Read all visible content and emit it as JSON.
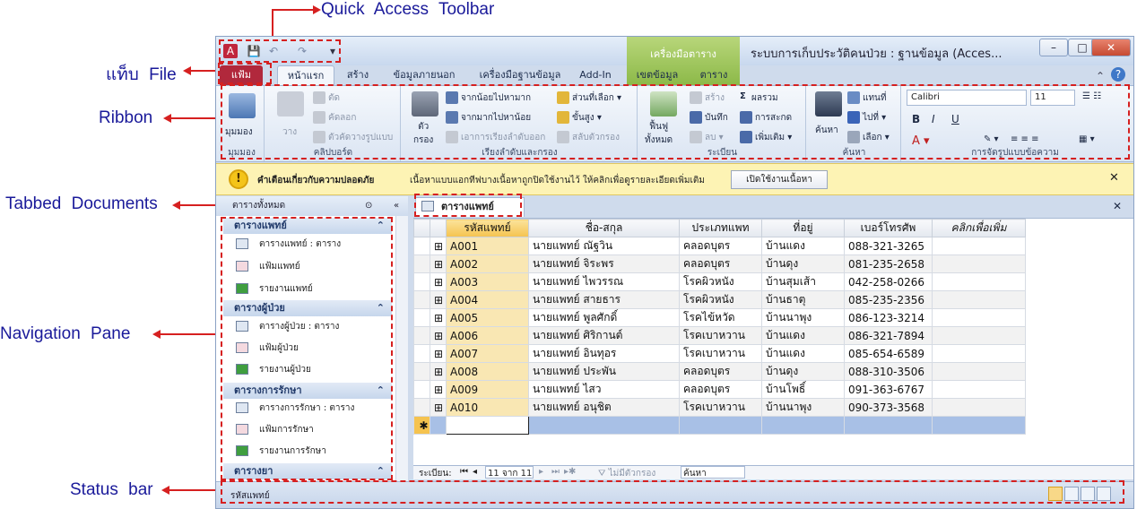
{
  "annotations": {
    "quick_access_toolbar": "Quick Access Toolbar",
    "file_tab": "แท็บ File",
    "ribbon": "Ribbon",
    "tabbed_documents": "Tabbed Documents",
    "navigation_pane": "Navigation Pane",
    "status_bar": "Status bar"
  },
  "window": {
    "title": "ระบบการเก็บประวัติคนป่วย : ฐานข้อมูล (Acces...",
    "context_tab_group": "เครื่องมือตาราง",
    "minimize": "–",
    "maximize": "□",
    "close": "✕"
  },
  "tabs": [
    "แฟ้ม",
    "หน้าแรก",
    "สร้าง",
    "ข้อมูลภายนอก",
    "เครื่องมือฐานข้อมูล",
    "Add-In",
    "เขตข้อมูล",
    "ตาราง"
  ],
  "ribbon": {
    "views": {
      "button": "มุมมอง",
      "group": "มุมมอง"
    },
    "clipboard": {
      "paste": "วาง",
      "cut": "ตัด",
      "copy": "คัดลอก",
      "format_painter": "ตัวคัดวางรูปแบบ",
      "group": "คลิปบอร์ด"
    },
    "sort": {
      "filter": "ตัว\nกรอง",
      "asc": "จากน้อยไปหามาก",
      "desc": "จากมากไปหาน้อย",
      "clear": "เอาการเรียงลำดับออก",
      "selection": "ส่วนที่เลือก",
      "advanced": "ขั้นสูง",
      "toggle": "สลับตัวกรอง",
      "group": "เรียงลำดับและกรอง"
    },
    "records": {
      "refresh": "ฟื้นฟู\nทั้งหมด",
      "new": "สร้าง",
      "save": "บันทึก",
      "delete": "ลบ",
      "totals": "ผลรวม",
      "spelling": "การสะกด",
      "more": "เพิ่มเติม",
      "group": "ระเบียน"
    },
    "find": {
      "find": "ค้นหา",
      "replace": "แทนที่",
      "goto": "ไปที่",
      "select": "เลือก",
      "group": "ค้นหา"
    },
    "text": {
      "font": "Calibri",
      "size": "11",
      "group": "การจัดรูปแบบข้อความ"
    }
  },
  "message_bar": {
    "title": "คำเตือนเกี่ยวกับความปลอดภัย",
    "text": "เนื้อหาแบบแอกทีฟบางเนื้อหาถูกปิดใช้งานไว้ ให้คลิกเพื่อดูรายละเอียดเพิ่มเติม",
    "button": "เปิดใช้งานเนื้อหา"
  },
  "nav_pane": {
    "header": "ตารางทั้งหมด",
    "groups": [
      {
        "title": "ตารางแพทย์",
        "items": [
          "ตารางแพทย์ : ตาราง",
          "แฟ้มแพทย์",
          "รายงานแพทย์"
        ]
      },
      {
        "title": "ตารางผู้ป่วย",
        "items": [
          "ตารางผู้ป่วย : ตาราง",
          "แฟ้มผู้ป่วย",
          "รายงานผู้ป่วย"
        ]
      },
      {
        "title": "ตารางการรักษา",
        "items": [
          "ตารางการรักษา : ตาราง",
          "แฟ้มการรักษา",
          "รายงานการรักษา"
        ]
      },
      {
        "title": "ตารางยา",
        "items": []
      }
    ]
  },
  "document_tab": "ตารางแพทย์",
  "datasheet": {
    "columns": [
      "รหัสแพทย์",
      "ชื่อ-สกุล",
      "ประเภทแพท",
      "ที่อยู่",
      "เบอร์โทรศัพ",
      "คลิกเพื่อเพิ่ม"
    ],
    "rows": [
      [
        "A001",
        "นายแพทย์ ณัฐวิน",
        "คลอดบุตร",
        "บ้านแดง",
        "088-321-3265"
      ],
      [
        "A002",
        "นายแพทย์ จิระพร",
        "คลอดบุตร",
        "บ้านดุง",
        "081-235-2658"
      ],
      [
        "A003",
        "นายแพทย์ ไพวรรณ",
        "โรคผิวหนัง",
        "บ้านสุมเส้า",
        "042-258-0266"
      ],
      [
        "A004",
        "นายแพทย์ สายธาร",
        "โรคผิวหนัง",
        "บ้านธาตุ",
        "085-235-2356"
      ],
      [
        "A005",
        "นายแพทย์ พูลศักดิ์",
        "โรคไข้หวัด",
        "บ้านนาพุง",
        "086-123-3214"
      ],
      [
        "A006",
        "นายแพทย์ ศิริกานต์",
        "โรคเบาหวาน",
        "บ้านแดง",
        "086-321-7894"
      ],
      [
        "A007",
        "นายแพทย์ อินทุอร",
        "โรคเบาหวาน",
        "บ้านแดง",
        "085-654-6589"
      ],
      [
        "A008",
        "นายแพทย์ ประพัน",
        "คลอดบุตร",
        "บ้านดุง",
        "088-310-3506"
      ],
      [
        "A009",
        "นายแพทย์ ไสว",
        "คลอดบุตร",
        "บ้านโพธิ์",
        "091-363-6767"
      ],
      [
        "A010",
        "นายแพทย์ อนุชิต",
        "โรคเบาหวาน",
        "บ้านนาพุง",
        "090-373-3568"
      ]
    ],
    "new_row_marker": "✱"
  },
  "record_nav": {
    "label": "ระเบียน:",
    "position": "11 จาก 11",
    "filter": "ไม่มีตัวกรอง",
    "search": "ค้นหา"
  },
  "status": {
    "text": "รหัสแพทย์"
  }
}
